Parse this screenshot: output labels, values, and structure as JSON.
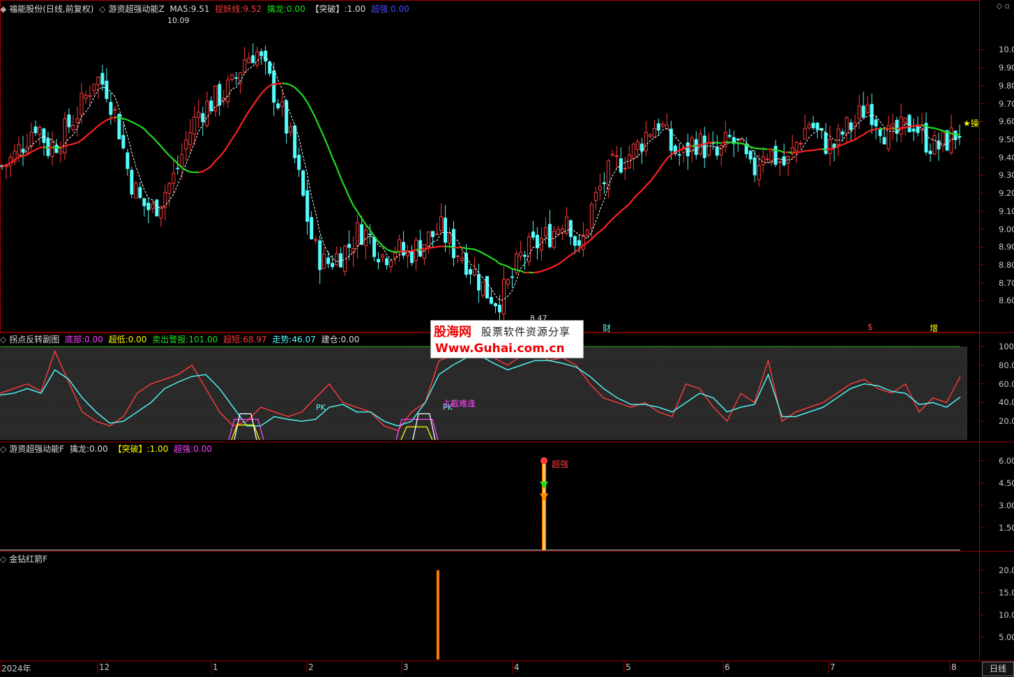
{
  "main_header": {
    "stock": "福能股份(日线,前复权)",
    "indicator": "游资超强动能Z",
    "ma5_label": "MA5:",
    "ma5_value": "9.51",
    "zy_label": "捉妖线:",
    "zy_value": "9.52",
    "ql_label": "擒龙:",
    "ql_value": "0.00",
    "tp_label": "【突破】:",
    "tp_value": "1.00",
    "cq_label": "超强:",
    "cq_value": "0.00"
  },
  "sub1_header": {
    "name": "拐点反转副图",
    "db_label": "底部:",
    "db_value": "0.00",
    "cd_label": "超低:",
    "cd_value": "0.00",
    "mc_label": "卖出警报:",
    "mc_value": "101.00",
    "cdu_label": "超短:",
    "cdu_value": "68.97",
    "zs_label": "走势:",
    "zs_value": "46.07",
    "jc_label": "建仓:",
    "jc_value": "0.00"
  },
  "sub2_header": {
    "name": "游资超强动能F",
    "ql_label": "擒龙:",
    "ql_value": "0.00",
    "tp_label": "【突破】:",
    "tp_value": "1.00",
    "cq_label": "超强:",
    "cq_value": "0.00"
  },
  "sub3_header": {
    "name": "金钻红箭F"
  },
  "annotations": {
    "high": "10.09",
    "low": "8.47",
    "pk1": "PK",
    "pk2": "PK",
    "tj": "占截难逢",
    "cq": "超强",
    "cai": "财",
    "s": "$",
    "zeng": "增",
    "star": "★操"
  },
  "watermark": {
    "cn": "股海网",
    "slogan": "股票软件资源分享",
    "url": "Www.Guhai.com.cn"
  },
  "period_tab": "日线",
  "colors": {
    "up": "#ff3c3c",
    "down": "#54fcfc",
    "ma_red": "#ff2020",
    "ma_green": "#22dd22",
    "yellow": "#ffff00",
    "magenta": "#ff44ff",
    "orange": "#ff8c00"
  },
  "chart_data": [
    {
      "type": "candlestick",
      "title": "游资超强动能Z",
      "yticks": [
        "10.00",
        "9.90",
        "9.80",
        "9.70",
        "9.60",
        "9.50",
        "9.40",
        "9.30",
        "9.20",
        "9.10",
        "9.00",
        "8.90",
        "8.80",
        "8.70",
        "8.60"
      ],
      "ylim": [
        8.45,
        10.2
      ],
      "x_labels": [
        "2024年",
        "12",
        "1",
        "2",
        "3",
        "4",
        "5",
        "6",
        "7",
        "8"
      ],
      "seed_close": [
        9.35,
        9.4,
        9.5,
        9.6,
        9.45,
        9.5,
        9.6,
        9.7,
        9.85,
        9.8,
        9.6,
        9.3,
        9.15,
        9.1,
        9.2,
        9.3,
        9.5,
        9.65,
        9.7,
        9.75,
        9.8,
        9.95,
        10.0,
        9.85,
        9.7,
        9.5,
        9.2,
        8.9,
        8.8,
        8.85,
        8.9,
        9.0,
        8.95,
        8.85,
        8.9,
        8.85,
        8.9,
        8.95,
        9.0,
        8.9,
        8.85,
        8.75,
        8.65,
        8.6,
        8.7,
        8.85,
        8.9,
        8.95,
        9.0,
        9.1,
        8.85,
        9.1,
        9.25,
        9.35,
        9.4,
        9.45,
        9.55,
        9.6,
        9.45,
        9.4,
        9.5,
        9.45,
        9.4,
        9.5,
        9.45,
        9.3,
        9.45,
        9.4,
        9.35,
        9.5,
        9.6,
        9.5,
        9.45,
        9.55,
        9.6,
        9.7,
        9.6,
        9.5,
        9.55,
        9.6,
        9.5,
        9.45,
        9.5,
        9.55
      ]
    },
    {
      "type": "line",
      "title": "拐点反转副图",
      "yticks": [
        "100.0",
        "80.00",
        "60.00",
        "40.00",
        "20.00"
      ],
      "ylim": [
        0,
        100
      ],
      "series": [
        {
          "name": "超短",
          "values": [
            50,
            55,
            60,
            52,
            95,
            62,
            30,
            20,
            15,
            25,
            50,
            60,
            65,
            70,
            80,
            55,
            30,
            15,
            20,
            35,
            30,
            25,
            30,
            45,
            60,
            40,
            35,
            30,
            15,
            10,
            30,
            40,
            85,
            90,
            95,
            92,
            88,
            80,
            90,
            95,
            85,
            88,
            80,
            60,
            45,
            40,
            35,
            40,
            30,
            25,
            60,
            55,
            35,
            20,
            50,
            40,
            85,
            20,
            30,
            35,
            40,
            50,
            60,
            65,
            55,
            50,
            60,
            30,
            45,
            40,
            68
          ]
        },
        {
          "name": "走势",
          "values": [
            48,
            50,
            55,
            50,
            75,
            65,
            45,
            30,
            18,
            20,
            30,
            40,
            55,
            62,
            68,
            70,
            55,
            35,
            15,
            15,
            25,
            22,
            20,
            22,
            35,
            38,
            30,
            30,
            20,
            15,
            20,
            40,
            70,
            80,
            88,
            90,
            82,
            75,
            80,
            85,
            85,
            82,
            78,
            68,
            55,
            45,
            38,
            38,
            35,
            30,
            40,
            50,
            45,
            30,
            35,
            38,
            70,
            25,
            25,
            30,
            35,
            45,
            55,
            60,
            58,
            52,
            50,
            38,
            40,
            35,
            46
          ]
        }
      ]
    },
    {
      "type": "bar",
      "title": "游资超强动能F",
      "yticks": [
        "6.00",
        "4.50",
        "3.00",
        "1.50"
      ],
      "ylim": [
        0,
        6.5
      ]
    },
    {
      "type": "bar",
      "title": "金钻红箭F",
      "yticks": [
        "20.00",
        "15.00",
        "10.00",
        "5.00"
      ],
      "ylim": [
        0,
        22
      ]
    }
  ]
}
